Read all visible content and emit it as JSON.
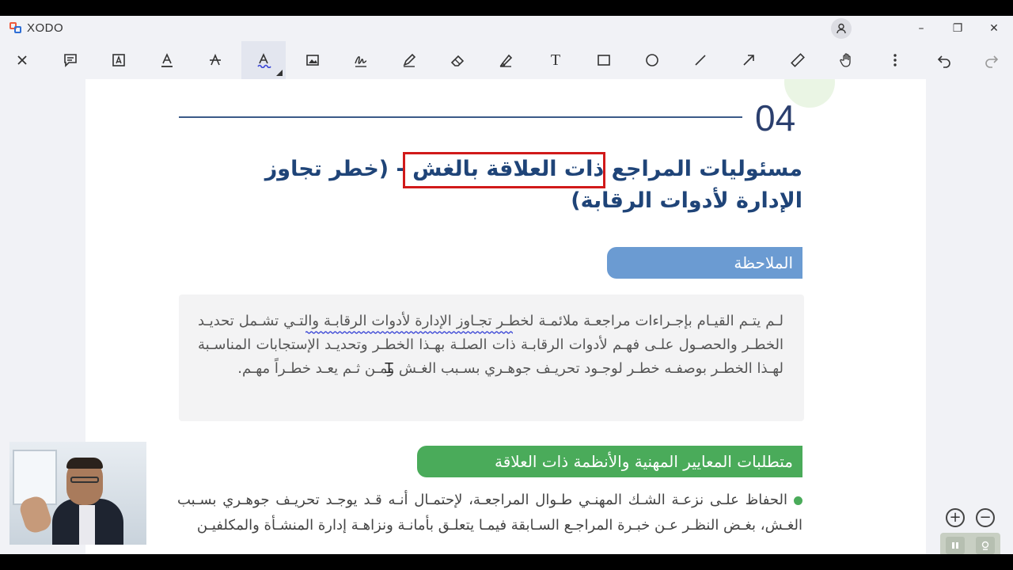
{
  "app": {
    "name": "XODO"
  },
  "window": {
    "minimize": "–",
    "restore": "❐",
    "close": "✕"
  },
  "toolbar": {
    "tools": [
      {
        "name": "close-tool-button",
        "icon": "close-icon"
      },
      {
        "name": "comment-tool-button",
        "icon": "comment-icon"
      },
      {
        "name": "free-text-tool-button",
        "icon": "text-box-icon"
      },
      {
        "name": "underline-tool-button",
        "icon": "underline-icon"
      },
      {
        "name": "strikeout-tool-button",
        "icon": "strikeout-icon"
      },
      {
        "name": "squiggly-tool-button",
        "icon": "squiggly-icon"
      },
      {
        "name": "image-tool-button",
        "icon": "image-icon"
      },
      {
        "name": "signature-tool-button",
        "icon": "signature-icon"
      },
      {
        "name": "pen-tool-button",
        "icon": "pen-icon"
      },
      {
        "name": "eraser-tool-button",
        "icon": "eraser-icon"
      },
      {
        "name": "highlighter-tool-button",
        "icon": "highlighter-icon"
      },
      {
        "name": "text-tool-button",
        "icon": "text-icon"
      },
      {
        "name": "rectangle-tool-button",
        "icon": "rectangle-icon"
      },
      {
        "name": "ellipse-tool-button",
        "icon": "ellipse-icon"
      },
      {
        "name": "line-tool-button",
        "icon": "line-icon"
      },
      {
        "name": "arrow-tool-button",
        "icon": "arrow-icon"
      },
      {
        "name": "ruler-tool-button",
        "icon": "ruler-icon"
      },
      {
        "name": "pan-tool-button",
        "icon": "hand-icon"
      },
      {
        "name": "more-tool-button",
        "icon": "more-vertical-icon"
      },
      {
        "name": "undo-button",
        "icon": "undo-icon"
      },
      {
        "name": "redo-button",
        "icon": "redo-icon"
      }
    ],
    "text_tool_glyph": "T",
    "active_tool": "squiggly-tool-button"
  },
  "document": {
    "section_number": "04",
    "heading": "مسئوليات المراجع ذات العلاقة بالغش - (خطر تجاوز الإدارة لأدوات الرقابة)",
    "note_title": "الملاحظة",
    "note_text": "لـم يتـم القيـام بإجـراءات مراجعـة ملائمـة لخطـر تجـاوز الإدارة لأدوات الرقابـة والتـي تشـمل تحديـد الخطـر والحصـول علـى فهـم لأدوات الرقابـة ذات الصلـة بهـذا الخطـر وتحديـد الإستجابات المناسـبة لهـذا الخطـر بوصفـه خطـر لوجـود تحريـف جوهـري بسـبب الغـش ومـن ثـم يعـد خطـراً مهـم.",
    "requirements_title": "متطلبات المعايير المهنية والأنظمة ذات العلاقة",
    "bullet_text": "الحفاظ علـى نزعـة الشـك المهنـي طـوال المراجعـة، لإحتمـال أنـه قـد يوجـد تحريـف جوهـري بسـبب الغـش، بغـض النظـر عـن خبـرة المراجـع السـابقة فيمـا يتعلـق بأمانـة ونزاهـة إدارة المنشـأة والمكلفيـن"
  },
  "zoom": {
    "in": "+",
    "out": "−"
  },
  "colors": {
    "heading": "#1f4478",
    "note_tab": "#6b9bd2",
    "requirements_tab": "#4aab5a",
    "highlight_border": "#d11a1a"
  }
}
